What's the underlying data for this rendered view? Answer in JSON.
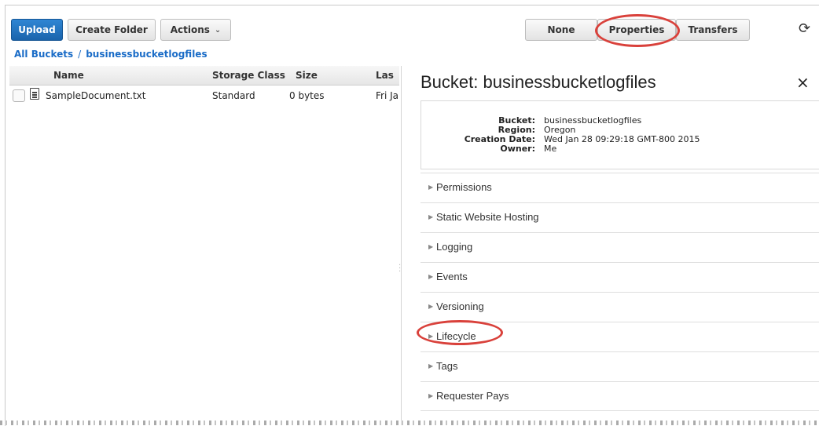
{
  "toolbar": {
    "upload": "Upload",
    "create_folder": "Create Folder",
    "actions": "Actions",
    "view_none": "None",
    "view_properties": "Properties",
    "view_transfers": "Transfers"
  },
  "breadcrumb": {
    "root": "All Buckets",
    "sep": "/",
    "bucket": "businessbucketlogfiles"
  },
  "table": {
    "headers": [
      "Name",
      "Storage Class",
      "Size",
      "Las"
    ],
    "rows": [
      {
        "name": "SampleDocument.txt",
        "storage_class": "Standard",
        "size": "0 bytes",
        "last_modified": "Fri Ja"
      }
    ]
  },
  "panel": {
    "title": "Bucket: businessbucketlogfiles",
    "close": "×",
    "info": {
      "bucket_key": "Bucket:",
      "bucket_val": "businessbucketlogfiles",
      "region_key": "Region:",
      "region_val": "Oregon",
      "created_key": "Creation Date:",
      "created_val": "Wed Jan 28 09:29:18 GMT-800 2015",
      "owner_key": "Owner:",
      "owner_val": "Me"
    },
    "sections": [
      "Permissions",
      "Static Website Hosting",
      "Logging",
      "Events",
      "Versioning",
      "Lifecycle",
      "Tags",
      "Requester Pays"
    ]
  },
  "icons": {
    "refresh": "refresh-icon",
    "close": "close-icon",
    "document": "document-icon",
    "chevron": "chevron-down-icon"
  },
  "colors": {
    "primary": "#1a64ac",
    "link": "#1a6cc7",
    "highlight": "#d9413b"
  }
}
